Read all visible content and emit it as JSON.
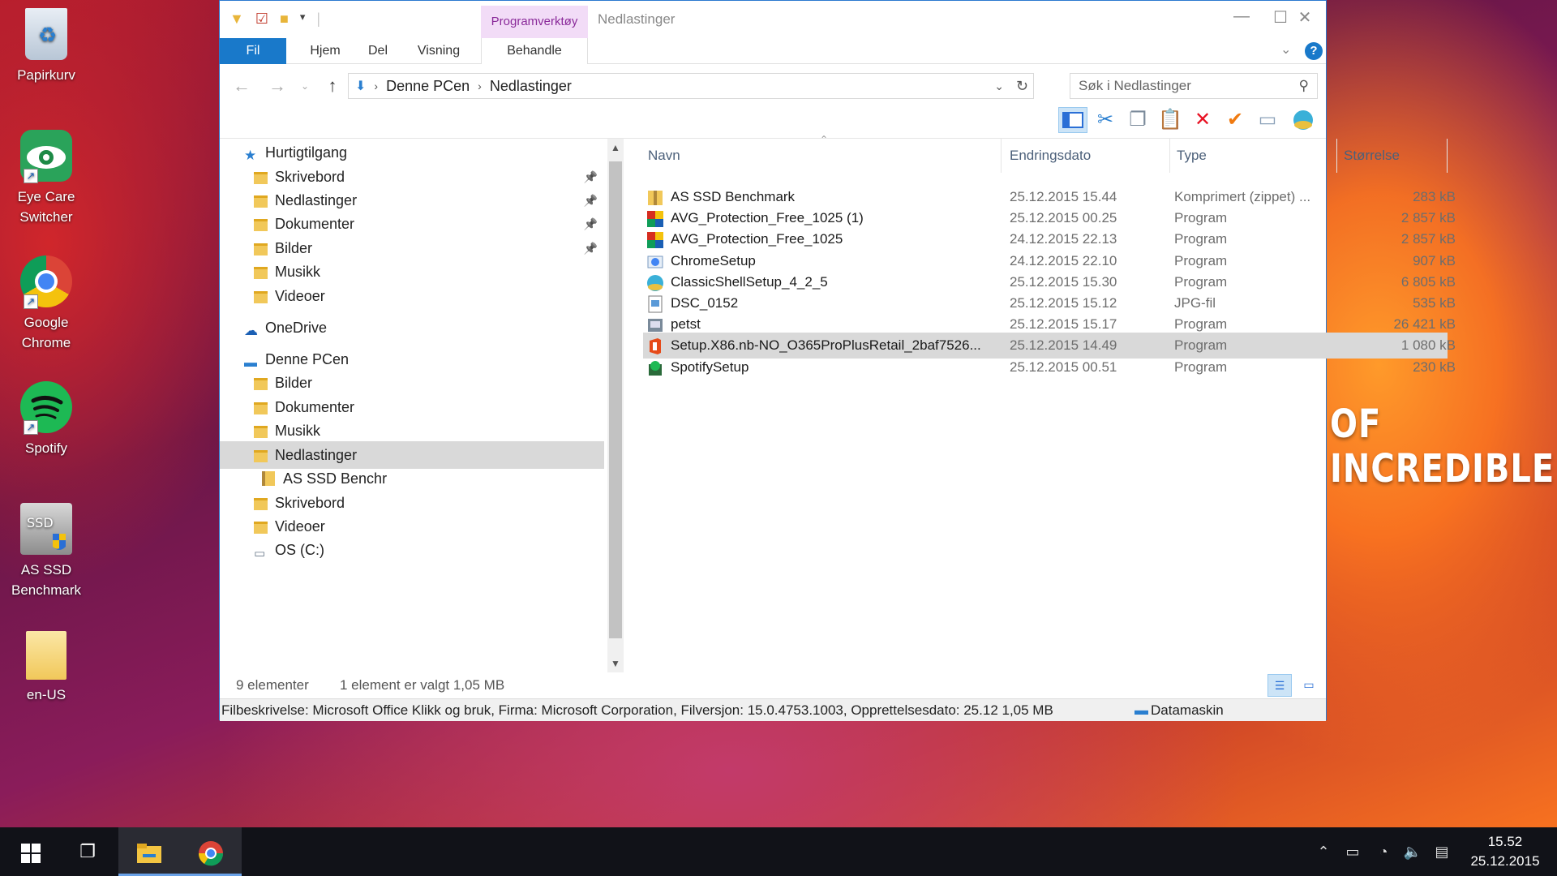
{
  "desktop": {
    "icons": [
      {
        "label": "Papirkurv"
      },
      {
        "label": "Eye Care Switcher"
      },
      {
        "label": "Google Chrome"
      },
      {
        "label": "Spotify"
      },
      {
        "label": "AS SSD Benchmark"
      },
      {
        "label": "en-US"
      }
    ],
    "wallpaper_text": "OF INCREDIBLE"
  },
  "window": {
    "title": "Nedlastinger",
    "context_tab_group": "Programverktøy",
    "ribbon_tabs": [
      "Fil",
      "Hjem",
      "Del",
      "Visning",
      "Behandle"
    ],
    "help_label": "?"
  },
  "address": {
    "path": [
      "Denne PCen",
      "Nedlastinger"
    ],
    "search_placeholder": "Søk i Nedlastinger"
  },
  "nav": {
    "items": [
      {
        "label": "Hurtigtilgang",
        "pinned": false,
        "indent": 0,
        "selected": false
      },
      {
        "label": "Skrivebord",
        "pinned": true,
        "indent": 1,
        "selected": false
      },
      {
        "label": "Nedlastinger",
        "pinned": true,
        "indent": 1,
        "selected": false
      },
      {
        "label": "Dokumenter",
        "pinned": true,
        "indent": 1,
        "selected": false
      },
      {
        "label": "Bilder",
        "pinned": true,
        "indent": 1,
        "selected": false
      },
      {
        "label": "Musikk",
        "pinned": false,
        "indent": 1,
        "selected": false
      },
      {
        "label": "Videoer",
        "pinned": false,
        "indent": 1,
        "selected": false
      },
      {
        "label": "OneDrive",
        "pinned": false,
        "indent": 0,
        "selected": false
      },
      {
        "label": "Denne PCen",
        "pinned": false,
        "indent": 0,
        "selected": false
      },
      {
        "label": "Bilder",
        "pinned": false,
        "indent": 1,
        "selected": false
      },
      {
        "label": "Dokumenter",
        "pinned": false,
        "indent": 1,
        "selected": false
      },
      {
        "label": "Musikk",
        "pinned": false,
        "indent": 1,
        "selected": false
      },
      {
        "label": "Nedlastinger",
        "pinned": false,
        "indent": 1,
        "selected": true
      },
      {
        "label": "AS SSD Benchr",
        "pinned": false,
        "indent": 2,
        "selected": false
      },
      {
        "label": "Skrivebord",
        "pinned": false,
        "indent": 1,
        "selected": false
      },
      {
        "label": "Videoer",
        "pinned": false,
        "indent": 1,
        "selected": false
      },
      {
        "label": "OS (C:)",
        "pinned": false,
        "indent": 1,
        "selected": false
      }
    ]
  },
  "columns": {
    "name": "Navn",
    "date": "Endringsdato",
    "type": "Type",
    "size": "Størrelse"
  },
  "files": [
    {
      "name": "AS SSD Benchmark",
      "date": "25.12.2015 15.44",
      "type": "Komprimert (zippet) ...",
      "size": "283 kB",
      "icon": "zip-folder-icon",
      "selected": false
    },
    {
      "name": "AVG_Protection_Free_1025 (1)",
      "date": "25.12.2015 00.25",
      "type": "Program",
      "size": "2 857 kB",
      "icon": "avg-icon",
      "selected": false
    },
    {
      "name": "AVG_Protection_Free_1025",
      "date": "24.12.2015 22.13",
      "type": "Program",
      "size": "2 857 kB",
      "icon": "avg-icon",
      "selected": false
    },
    {
      "name": "ChromeSetup",
      "date": "24.12.2015 22.10",
      "type": "Program",
      "size": "907 kB",
      "icon": "installer-icon",
      "selected": false
    },
    {
      "name": "ClassicShellSetup_4_2_5",
      "date": "25.12.2015 15.30",
      "type": "Program",
      "size": "6 805 kB",
      "icon": "shell-icon",
      "selected": false
    },
    {
      "name": "DSC_0152",
      "date": "25.12.2015 15.12",
      "type": "JPG-fil",
      "size": "535 kB",
      "icon": "image-file-icon",
      "selected": false
    },
    {
      "name": "petst",
      "date": "25.12.2015 15.17",
      "type": "Program",
      "size": "26 421 kB",
      "icon": "program-icon",
      "selected": false
    },
    {
      "name": "Setup.X86.nb-NO_O365ProPlusRetail_2baf7526...",
      "date": "25.12.2015 14.49",
      "type": "Program",
      "size": "1 080 kB",
      "icon": "office-icon",
      "selected": true
    },
    {
      "name": "SpotifySetup",
      "date": "25.12.2015 00.51",
      "type": "Program",
      "size": "230 kB",
      "icon": "spotify-setup-icon",
      "selected": false
    }
  ],
  "status": {
    "count": "9 elementer",
    "selection": "1 element er valgt  1,05 MB"
  },
  "description": {
    "text": "Filbeskrivelse: Microsoft Office Klikk og bruk, Firma: Microsoft Corporation, Filversjon: 15.0.4753.1003, Opprettelsesdato: 25.12 1,05 MB",
    "zone": "Datamaskin"
  },
  "taskbar": {
    "time": "15.52",
    "date": "25.12.2015"
  },
  "colors": {
    "accent": "#1979ca",
    "selection": "#d9d9d9",
    "delete_red": "#e81123",
    "check_orange": "#f07a10"
  }
}
